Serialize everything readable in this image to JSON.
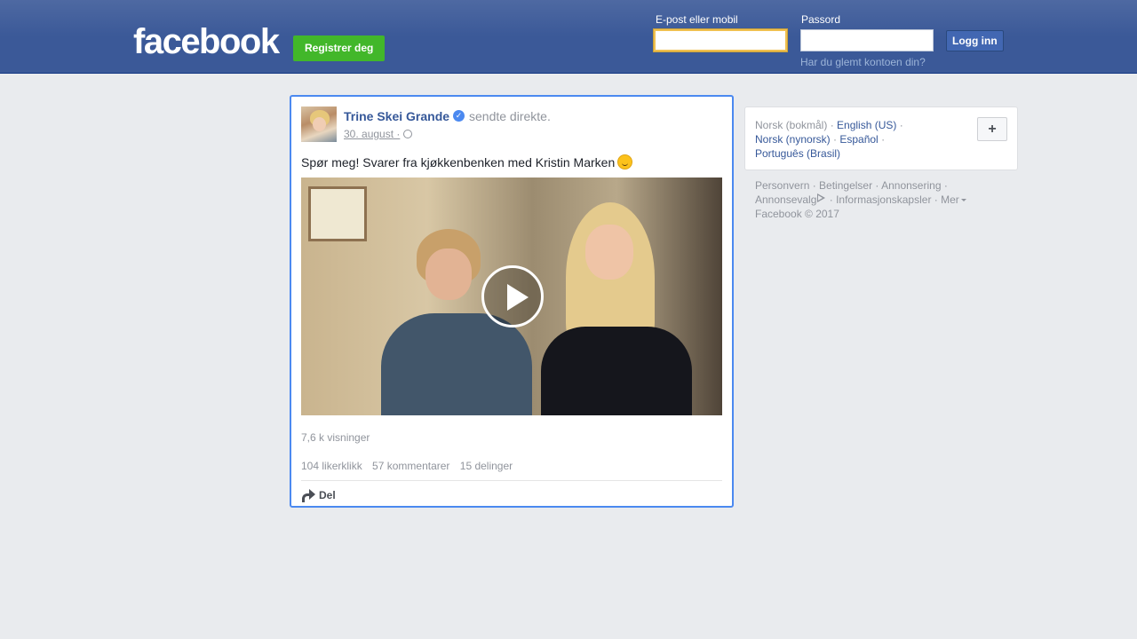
{
  "header": {
    "logo": "facebook",
    "register_label": "Registrer deg",
    "email_label": "E-post eller mobil",
    "password_label": "Passord",
    "login_label": "Logg inn",
    "forgot_link": "Har du glemt kontoen din?",
    "email_value": "",
    "password_value": ""
  },
  "post": {
    "author": "Trine Skei Grande",
    "action": "sendte direkte.",
    "date": "30. august ·",
    "text": "Spør meg! Svarer fra kjøkkenbenken med Kristin Marken",
    "views": "7,6 k visninger",
    "likes": "104 likerklikk",
    "comments": "57 kommentarer",
    "shares": "15 delinger",
    "share_label": "Del"
  },
  "languages": {
    "current": "Norsk (bokmål)",
    "options": [
      "English (US)",
      "Norsk (nynorsk)",
      "Español",
      "Português (Brasil)"
    ],
    "more_label": "+"
  },
  "footer": {
    "links": [
      "Personvern",
      "Betingelser",
      "Annonsering",
      "Annonsevalg",
      "Informasjonskapsler",
      "Mer"
    ],
    "copyright": "Facebook © 2017"
  },
  "colors": {
    "header_blue": "#3b5998",
    "register_green": "#42b72a",
    "link_blue": "#365899",
    "focus_border": "#4b89f0"
  }
}
